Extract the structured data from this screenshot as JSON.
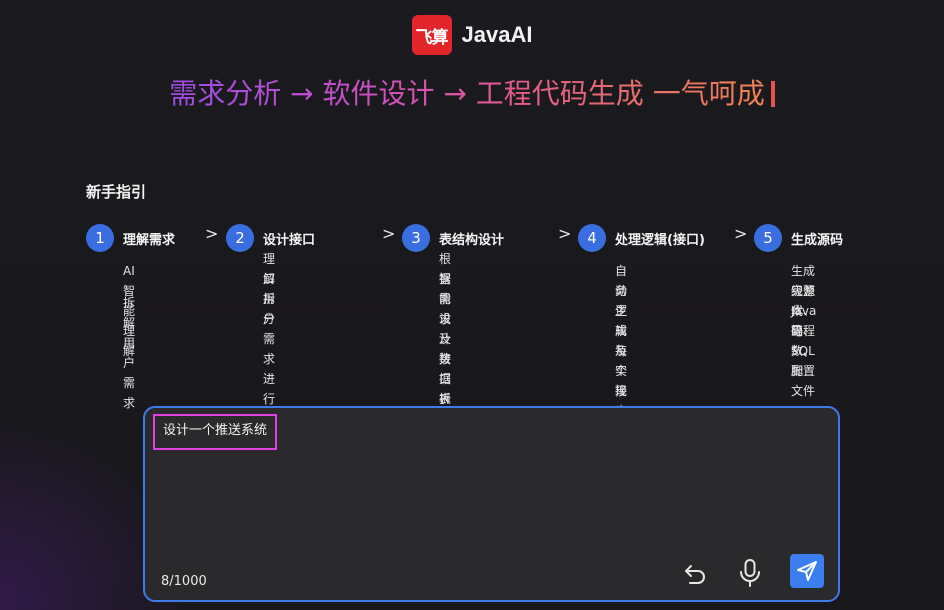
{
  "header": {
    "logo_text": "飞算",
    "app_name": "JavaAI"
  },
  "slogan": "需求分析 → 软件设计 → 工程代码生成 一气呵成",
  "guide": {
    "title": "新手指引",
    "steps": [
      {
        "num": "1",
        "title": "理解需求",
        "desc": [
          "AI智能理解",
          "拆解用户需求"
        ]
      },
      {
        "num": "2",
        "title": "设计接口",
        "desc": [
          "理解用户需求进行接",
          "口拆分"
        ]
      },
      {
        "num": "3",
        "title": "表结构设计",
        "desc": [
          "根据需求及接口拆分",
          "智能设计数据表结构"
        ]
      },
      {
        "num": "4",
        "title": "处理逻辑(接口)",
        "desc": [
          "自动生成每个接口业",
          "务逻辑及实现步骤"
        ]
      },
      {
        "num": "5",
        "title": "生成源码",
        "desc": [
          "生成完整Java 工程",
          "级源代码、SQL脚",
          "本、函数、配置文件",
          "等"
        ]
      }
    ],
    "separator": ">"
  },
  "input": {
    "value": "设计一个推送系统",
    "counter": "8/1000"
  },
  "icons": {
    "undo": "undo-icon",
    "mic": "microphone-icon",
    "send": "send-icon"
  },
  "colors": {
    "accent": "#3b7ef0",
    "logo": "#e2242b",
    "highlight_border": "#e23ee6"
  }
}
